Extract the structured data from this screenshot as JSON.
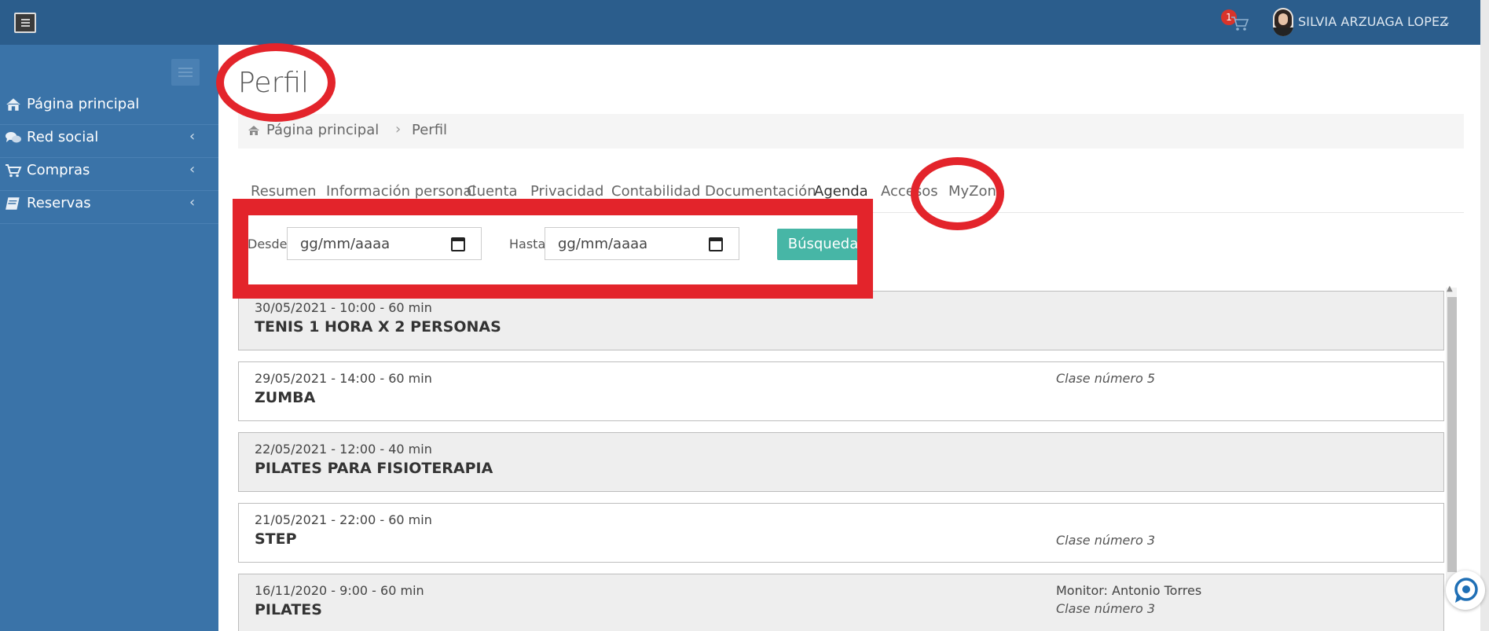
{
  "header": {
    "cart_count": "1",
    "user_name": "SILVIA ARZUAGA LOPEZ"
  },
  "sidebar": {
    "items": [
      {
        "label": "Página principal",
        "icon": "home-icon",
        "has_chevron": false
      },
      {
        "label": "Red social",
        "icon": "comments-icon",
        "has_chevron": true
      },
      {
        "label": "Compras",
        "icon": "cart-icon",
        "has_chevron": true
      },
      {
        "label": "Reservas",
        "icon": "book-icon",
        "has_chevron": true
      }
    ],
    "chevron": "‹"
  },
  "page": {
    "title": "Perfil",
    "breadcrumb": {
      "home": "Página principal",
      "separator": "›",
      "current": "Perfil"
    }
  },
  "tabs": [
    {
      "label": "Resumen"
    },
    {
      "label": "Información personal"
    },
    {
      "label": "Cuenta"
    },
    {
      "label": "Privacidad"
    },
    {
      "label": "Contabilidad"
    },
    {
      "label": "Documentación"
    },
    {
      "label": "Agenda",
      "active": true
    },
    {
      "label": "Accesos"
    },
    {
      "label": "MyZone"
    }
  ],
  "filters": {
    "from_label": "Desde",
    "from_value": "gg/mm/aaaa",
    "to_label": "Hasta",
    "to_value": "gg/mm/aaaa",
    "search_button": "Búsqueda"
  },
  "events": [
    {
      "datetime": "30/05/2021 - 10:00 - 60 min",
      "name": "TENIS 1 HORA X 2 PERSONAS",
      "monitor": "",
      "class_number": ""
    },
    {
      "datetime": "29/05/2021 - 14:00 - 60 min",
      "name": "ZUMBA",
      "monitor": "",
      "class_number": "Clase número 5"
    },
    {
      "datetime": "22/05/2021 - 12:00 - 40 min",
      "name": "PILATES PARA FISIOTERAPIA",
      "monitor": "",
      "class_number": ""
    },
    {
      "datetime": "21/05/2021 - 22:00 - 60 min",
      "name": "STEP",
      "monitor": "",
      "class_number": "Clase número 3"
    },
    {
      "datetime": "16/11/2020 - 9:00 - 60 min",
      "name": "PILATES",
      "monitor": "Monitor: Antonio Torres",
      "class_number": "Clase número 3"
    }
  ],
  "colors": {
    "topbar": "#2b5d8c",
    "sidebar": "#3a73a8",
    "button": "#47b6a6",
    "annotation": "#e3242b"
  }
}
